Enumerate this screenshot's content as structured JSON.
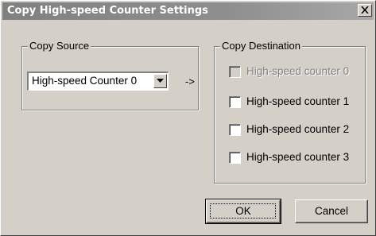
{
  "window": {
    "title": "Copy High-speed Counter Settings",
    "close_icon": "close-icon"
  },
  "copy_source": {
    "group_label": "Copy Source",
    "selected": "High-speed Counter 0",
    "dropdown_icon": "chevron-down-icon"
  },
  "arrow_text": "->",
  "copy_destination": {
    "group_label": "Copy Destination",
    "items": [
      {
        "label": "High-speed counter 0",
        "checked": false,
        "enabled": false
      },
      {
        "label": "High-speed counter 1",
        "checked": false,
        "enabled": true
      },
      {
        "label": "High-speed counter 2",
        "checked": false,
        "enabled": true
      },
      {
        "label": "High-speed counter 3",
        "checked": false,
        "enabled": true
      }
    ]
  },
  "buttons": {
    "ok_label": "OK",
    "cancel_label": "Cancel"
  }
}
